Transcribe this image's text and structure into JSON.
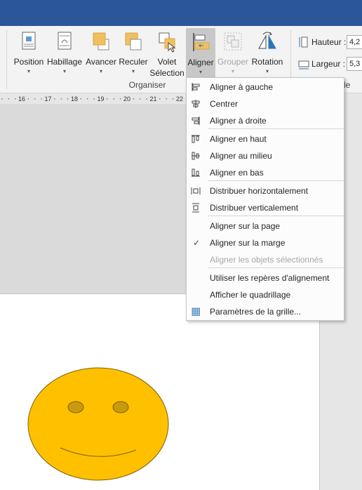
{
  "ribbon": {
    "buttons": {
      "position": "Position",
      "habillage": "Habillage",
      "avancer": "Avancer",
      "reculer": "Reculer",
      "volet_line1": "Volet",
      "volet_line2": "Sélection",
      "aligner": "Aligner",
      "grouper": "Grouper",
      "rotation": "Rotation"
    },
    "group_label": "Organiser",
    "size": {
      "height_label": "Hauteur :",
      "height_value": "4,2",
      "width_label": "Largeur :",
      "width_value": "5,3",
      "group_label_truncated": "le"
    }
  },
  "ruler": {
    "ticks": [
      "16",
      "17",
      "18",
      "19",
      "20",
      "21",
      "22"
    ]
  },
  "align_menu": {
    "items": [
      {
        "label": "Aligner à gauche",
        "icon": "align-left-icon"
      },
      {
        "label": "Centrer",
        "icon": "align-center-icon"
      },
      {
        "label": "Aligner à droite",
        "icon": "align-right-icon"
      },
      {
        "label": "Aligner en haut",
        "icon": "align-top-icon"
      },
      {
        "label": "Aligner au milieu",
        "icon": "align-middle-icon"
      },
      {
        "label": "Aligner en bas",
        "icon": "align-bottom-icon"
      },
      {
        "label": "Distribuer horizontalement",
        "icon": "distribute-horizontal-icon"
      },
      {
        "label": "Distribuer verticalement",
        "icon": "distribute-vertical-icon"
      },
      {
        "label": "Aligner sur la page",
        "icon": ""
      },
      {
        "label": "Aligner sur la marge",
        "icon": "checkmark-icon",
        "checked": true
      },
      {
        "label": "Aligner les objets sélectionnés",
        "icon": "",
        "disabled": true
      },
      {
        "label": "Utiliser les repères d'alignement",
        "icon": ""
      },
      {
        "label": "Afficher le quadrillage",
        "icon": ""
      },
      {
        "label": "Paramètres de la grille...",
        "icon": "grid-settings-icon"
      }
    ],
    "check_glyph": "✓"
  },
  "colors": {
    "titlebar": "#2b579a",
    "smiley_fill": "#ffc000",
    "smiley_stroke": "#7f6000",
    "eye_fill": "#c99a0c"
  }
}
